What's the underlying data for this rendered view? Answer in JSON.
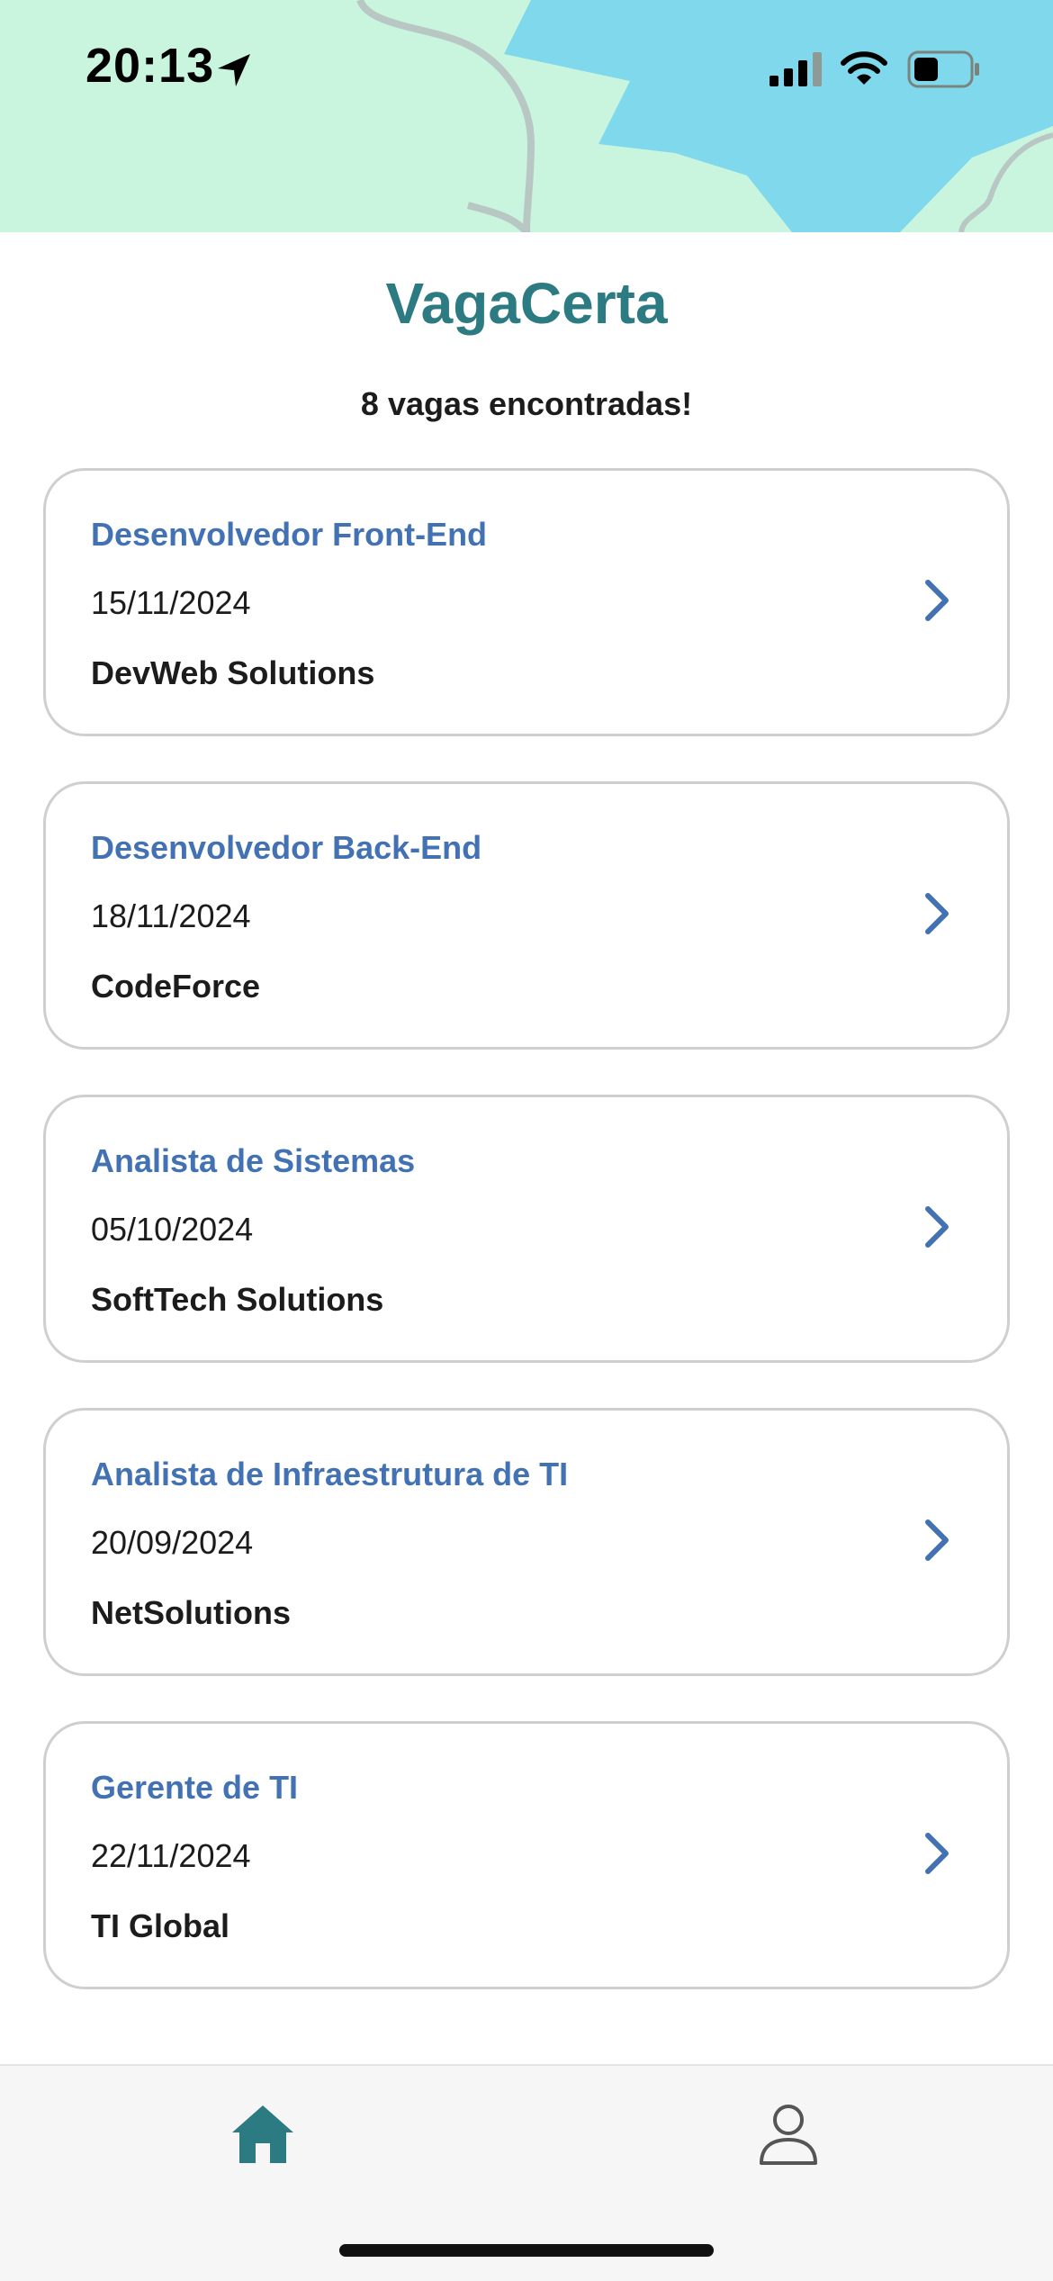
{
  "status_bar": {
    "time": "20:13",
    "icons": [
      "location-arrow-icon",
      "cellular-signal-icon",
      "wifi-icon",
      "battery-icon"
    ]
  },
  "header": {
    "title": "VagaCerta",
    "results_count": "8 vagas encontradas!"
  },
  "jobs": [
    {
      "title": "Desenvolvedor Front-End",
      "date": "15/11/2024",
      "company": "DevWeb Solutions"
    },
    {
      "title": "Desenvolvedor Back-End",
      "date": "18/11/2024",
      "company": "CodeForce"
    },
    {
      "title": "Analista de Sistemas",
      "date": "05/10/2024",
      "company": "SoftTech Solutions"
    },
    {
      "title": "Analista de Infraestrutura de TI",
      "date": "20/09/2024",
      "company": "NetSolutions"
    },
    {
      "title": "Gerente de TI",
      "date": "22/11/2024",
      "company": "TI Global"
    }
  ],
  "tab_bar": {
    "items": [
      "home-icon",
      "profile-icon"
    ],
    "active": "home-icon"
  },
  "colors": {
    "brand": "#2c7a82",
    "job_title": "#4272b3",
    "map_land": "#c9f5de",
    "map_water": "#7fd8ec"
  }
}
